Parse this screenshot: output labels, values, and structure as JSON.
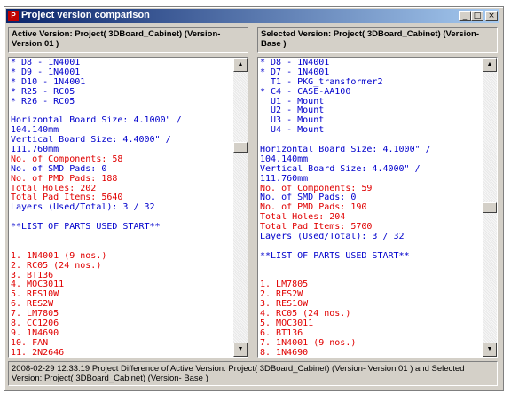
{
  "window": {
    "title": "Project version comparison",
    "app_icon": "app-logo-icon",
    "buttons": {
      "minimize": "_",
      "maximize": "□",
      "close": "×"
    }
  },
  "colors": {
    "blue": "#0000cc",
    "red": "#e00000",
    "title_bar": "#0a246a"
  },
  "left_pane": {
    "header": "Active Version: Project( 3DBoard_Cabinet) (Version- Version 01 )",
    "lines": [
      {
        "text": "* D8 - 1N4001",
        "color": "blue"
      },
      {
        "text": "* D9 - 1N4001",
        "color": "blue"
      },
      {
        "text": "* D10 - 1N4001",
        "color": "blue"
      },
      {
        "text": "* R25 - RC05",
        "color": "blue"
      },
      {
        "text": "* R26 - RC05",
        "color": "blue"
      },
      {
        "text": "",
        "color": "blue"
      },
      {
        "text": "Horizontal Board Size: 4.1000\" /",
        "color": "blue"
      },
      {
        "text": "104.140mm",
        "color": "blue"
      },
      {
        "text": "Vertical Board Size: 4.4000\" /",
        "color": "blue"
      },
      {
        "text": "111.760mm",
        "color": "blue"
      },
      {
        "text": "No. of Components: 58",
        "color": "red"
      },
      {
        "text": "No. of SMD Pads: 0",
        "color": "blue"
      },
      {
        "text": "No. of PMD Pads: 188",
        "color": "red"
      },
      {
        "text": "Total Holes: 202",
        "color": "red"
      },
      {
        "text": "Total Pad Items: 5640",
        "color": "red"
      },
      {
        "text": "Layers (Used/Total): 3 / 32",
        "color": "blue"
      },
      {
        "text": "",
        "color": "blue"
      },
      {
        "text": "**LIST OF PARTS USED START**",
        "color": "blue"
      },
      {
        "text": "",
        "color": "blue"
      },
      {
        "text": "",
        "color": "blue"
      },
      {
        "text": "1. 1N4001 (9 nos.)",
        "color": "red"
      },
      {
        "text": "2. RC05 (24 nos.)",
        "color": "red"
      },
      {
        "text": "3. BT136",
        "color": "red"
      },
      {
        "text": "4. MOC3011",
        "color": "red"
      },
      {
        "text": "5. RES10W",
        "color": "red"
      },
      {
        "text": "6. RES2W",
        "color": "red"
      },
      {
        "text": "7. LM7805",
        "color": "red"
      },
      {
        "text": "8. CC1206",
        "color": "red"
      },
      {
        "text": "9. 1N4690",
        "color": "red"
      },
      {
        "text": "10. FAN",
        "color": "red"
      },
      {
        "text": "11. 2N2646",
        "color": "red"
      }
    ],
    "scroll_position": 0.27
  },
  "right_pane": {
    "header": "Selected Version: Project( 3DBoard_Cabinet) (Version- Base )",
    "lines": [
      {
        "text": "* D8 - 1N4001",
        "color": "blue"
      },
      {
        "text": "* D7 - 1N4001",
        "color": "blue"
      },
      {
        "text": "  T1 - PKG_transformer2",
        "color": "blue"
      },
      {
        "text": "* C4 - CASE-AA100",
        "color": "blue"
      },
      {
        "text": "  U1 - Mount",
        "color": "blue"
      },
      {
        "text": "  U2 - Mount",
        "color": "blue"
      },
      {
        "text": "  U3 - Mount",
        "color": "blue"
      },
      {
        "text": "  U4 - Mount",
        "color": "blue"
      },
      {
        "text": "",
        "color": "blue"
      },
      {
        "text": "Horizontal Board Size: 4.1000\" /",
        "color": "blue"
      },
      {
        "text": "104.140mm",
        "color": "blue"
      },
      {
        "text": "Vertical Board Size: 4.4000\" /",
        "color": "blue"
      },
      {
        "text": "111.760mm",
        "color": "blue"
      },
      {
        "text": "No. of Components: 59",
        "color": "red"
      },
      {
        "text": "No. of SMD Pads: 0",
        "color": "blue"
      },
      {
        "text": "No. of PMD Pads: 190",
        "color": "red"
      },
      {
        "text": "Total Holes: 204",
        "color": "red"
      },
      {
        "text": "Total Pad Items: 5700",
        "color": "red"
      },
      {
        "text": "Layers (Used/Total): 3 / 32",
        "color": "blue"
      },
      {
        "text": "",
        "color": "blue"
      },
      {
        "text": "**LIST OF PARTS USED START**",
        "color": "blue"
      },
      {
        "text": "",
        "color": "blue"
      },
      {
        "text": "",
        "color": "blue"
      },
      {
        "text": "1. LM7805",
        "color": "red"
      },
      {
        "text": "2. RES2W",
        "color": "red"
      },
      {
        "text": "3. RES10W",
        "color": "red"
      },
      {
        "text": "4. RC05 (24 nos.)",
        "color": "red"
      },
      {
        "text": "5. MOC3011",
        "color": "red"
      },
      {
        "text": "6. BT136",
        "color": "red"
      },
      {
        "text": "7. 1N4001 (9 nos.)",
        "color": "red"
      },
      {
        "text": "8. 1N4690",
        "color": "red"
      }
    ],
    "scroll_position": 0.5
  },
  "status": {
    "text": "2008-02-29 12:33:19 Project Difference of Active Version: Project( 3DBoard_Cabinet) (Version- Version 01 )  and Selected Version: Project( 3DBoard_Cabinet) (Version- Base )"
  }
}
